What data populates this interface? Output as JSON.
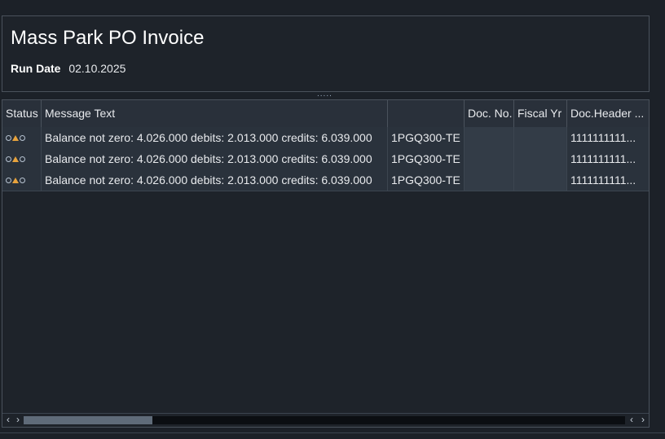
{
  "header": {
    "title": "Mass Park PO Invoice",
    "run_date_label": "Run Date",
    "run_date_value": "02.10.2025"
  },
  "splitter": {
    "handle": "....."
  },
  "table": {
    "columns": [
      "Status",
      "Message Text",
      "",
      "Doc. No.",
      "Fiscal Yr",
      "Doc.Header ..."
    ],
    "rows": [
      {
        "status_icons": [
          "circle-icon",
          "warning-triangle-icon",
          "circle-icon"
        ],
        "message": "Balance not zero: 4.026.000  debits: 2.013.000  credits: 6.039.000",
        "ref": "1PGQ300-TE",
        "doc_no": "",
        "fiscal_yr": "",
        "doc_header": "1111111111..."
      },
      {
        "status_icons": [
          "circle-icon",
          "warning-triangle-icon",
          "circle-icon"
        ],
        "message": "Balance not zero: 4.026.000  debits: 2.013.000  credits: 6.039.000",
        "ref": "1PGQ300-TE",
        "doc_no": "",
        "fiscal_yr": "",
        "doc_header": "1111111111..."
      },
      {
        "status_icons": [
          "circle-icon",
          "warning-triangle-icon",
          "circle-icon"
        ],
        "message": "Balance not zero: 4.026.000  debits: 2.013.000  credits: 6.039.000",
        "ref": "1PGQ300-TE",
        "doc_no": "",
        "fiscal_yr": "",
        "doc_header": "1111111111..."
      }
    ]
  },
  "scrollbar": {
    "left_glyph": "‹",
    "right_glyph": "›",
    "thumb_position": 0.0
  },
  "colors": {
    "background": "#1c2128",
    "warning": "#e8a33d",
    "row_background": "#2a323c"
  }
}
